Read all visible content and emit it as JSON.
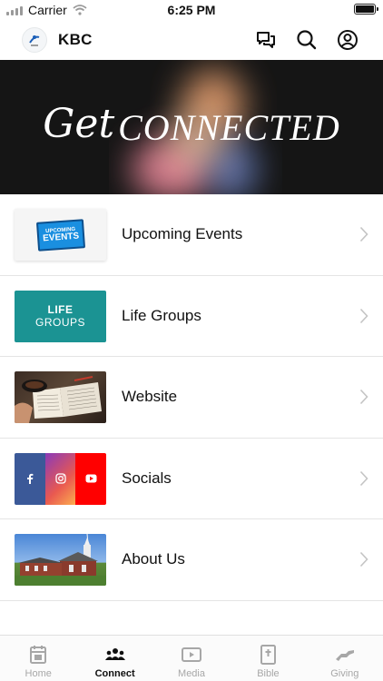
{
  "status_bar": {
    "carrier": "Carrier",
    "time": "6:25 PM"
  },
  "header": {
    "title": "KBC",
    "logo_icon": "church-logo-icon",
    "icons": [
      "chat-icon",
      "search-icon",
      "profile-icon"
    ]
  },
  "hero": {
    "title_script": "Get",
    "title_main": "CONNECTED"
  },
  "list": {
    "items": [
      {
        "label": "Upcoming Events",
        "thumb_line1": "UPCOMING",
        "thumb_line2": "EVENTS"
      },
      {
        "label": "Life Groups",
        "thumb_line1": "LIFE",
        "thumb_line2": "GROUPS"
      },
      {
        "label": "Website"
      },
      {
        "label": "Socials",
        "thumb_icons": [
          "facebook-icon",
          "instagram-icon",
          "youtube-icon"
        ]
      },
      {
        "label": "About Us"
      }
    ]
  },
  "tabs": [
    {
      "label": "Home",
      "icon": "home-icon",
      "active": false
    },
    {
      "label": "Connect",
      "icon": "connect-icon",
      "active": true
    },
    {
      "label": "Media",
      "icon": "media-icon",
      "active": false
    },
    {
      "label": "Bible",
      "icon": "bible-icon",
      "active": false
    },
    {
      "label": "Giving",
      "icon": "giving-icon",
      "active": false
    }
  ],
  "colors": {
    "life_groups_teal": "#1b9393",
    "events_blue": "#1a8fe0",
    "facebook": "#3b5998",
    "youtube": "#ff0000",
    "tab_inactive": "#a7a7a7"
  }
}
